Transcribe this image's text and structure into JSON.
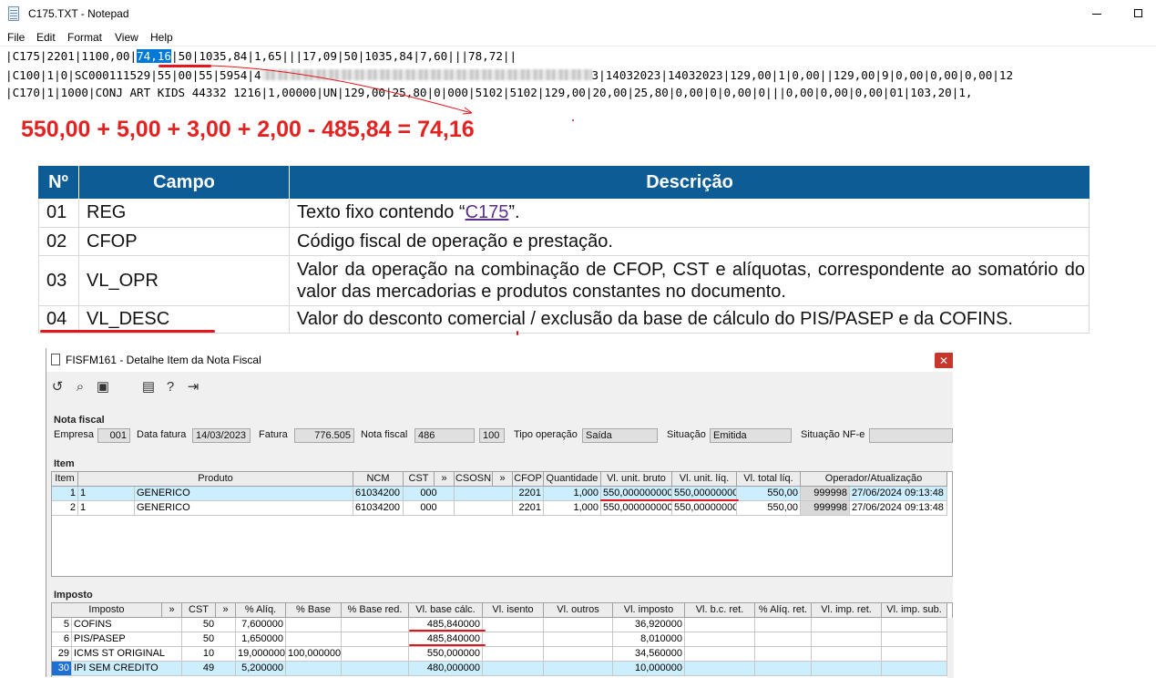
{
  "notepad": {
    "title": "C175.TXT - Notepad",
    "menu": [
      "File",
      "Edit",
      "Format",
      "View",
      "Help"
    ],
    "line1": {
      "pre": "|C175|2201|1100,00|",
      "selected": "74,16",
      "post": "|50|1035,84|1,65|||17,09|50|1035,84|7,60|||78,72||"
    },
    "line2": {
      "pre": "|C100|1|0|SC000111529|55|00|55|5954|4",
      "post": "3|14032023|14032023|129,00|1|0,00||129,00|9|0,00|0,00|0,00|12"
    },
    "line3": "|C170|1|1000|CONJ ART KIDS 44332 1216|1,00000|UN|129,00|25,80|0|000|5102|5102|129,00|20,00|25,80|0,00|0|0,00|0|||0,00|0,00|0,00|01|103,20|1,"
  },
  "formula": "550,00 + 5,00 + 3,00 + 2,00 - 485,84 = 74,16",
  "c175_table": {
    "headers": [
      "Nº",
      "Campo",
      "Descrição"
    ],
    "rows": [
      {
        "n": "01",
        "campo": "REG",
        "desc_pre": "Texto fixo contendo “",
        "desc_link": "C175",
        "desc_post": "”."
      },
      {
        "n": "02",
        "campo": "CFOP",
        "desc": "Código fiscal de operação e prestação."
      },
      {
        "n": "03",
        "campo": "VL_OPR",
        "desc": "Valor da operação na combinação de CFOP, CST e alíquotas, correspondente ao somatório do valor das mercadorias e produtos constantes no documento."
      },
      {
        "n": "04",
        "campo": "VL_DESC",
        "desc": "Valor do desconto comercial / exclusão da base de cálculo do PIS/PASEP e da COFINS."
      }
    ]
  },
  "form": {
    "title": "FISFM161 - Detalhe Item da Nota Fiscal",
    "close_label": "✕",
    "nota_fiscal": {
      "section": "Nota fiscal",
      "empresa_label": "Empresa",
      "empresa": "001",
      "data_fatura_label": "Data fatura",
      "data_fatura": "14/03/2023",
      "fatura_label": "Fatura",
      "fatura": "776.505",
      "nota_fiscal_label": "Nota fiscal",
      "nota_fiscal": "486",
      "serie": "100",
      "tipo_operacao_label": "Tipo operação",
      "tipo_operacao": "Saída",
      "situacao_label": "Situação",
      "situacao": "Emitida",
      "situacao_nfe_label": "Situação NF-e",
      "situacao_nfe": ""
    },
    "item": {
      "section": "Item",
      "headers": [
        "Item",
        "Produto",
        "NCM",
        "CST",
        "»",
        "CSOSN",
        "»",
        "CFOP",
        "Quantidade",
        "Vl. unit. bruto",
        "Vl. unit. líq.",
        "Vl. total líq.",
        "Operador/Atualização"
      ],
      "rows": [
        {
          "item": "1",
          "cod": "1",
          "produto": "GENERICO",
          "ncm": "61034200",
          "cst": "000",
          "csosn": "",
          "cfop": "2201",
          "quantidade": "1,000",
          "unit_bruto": "550,000000000",
          "unit_liq": "550,000000000",
          "total_liq": "550,00",
          "operador": "999998",
          "atualizacao": "27/06/2024 09:13:48"
        },
        {
          "item": "2",
          "cod": "1",
          "produto": "GENERICO",
          "ncm": "61034200",
          "cst": "000",
          "csosn": "",
          "cfop": "2201",
          "quantidade": "1,000",
          "unit_bruto": "550,000000000",
          "unit_liq": "550,000000000",
          "total_liq": "550,00",
          "operador": "999998",
          "atualizacao": "27/06/2024 09:13:48"
        }
      ]
    },
    "imposto": {
      "section": "Imposto",
      "headers": [
        "Imposto",
        "»",
        "CST",
        "»",
        "% Alíq.",
        "% Base",
        "% Base red.",
        "Vl. base cálc.",
        "Vl. isento",
        "Vl. outros",
        "Vl. imposto",
        "Vl. b.c. ret.",
        "% Alíq. ret.",
        "Vl. imp. ret.",
        "Vl. imp. sub."
      ],
      "rows": [
        {
          "code": "5",
          "name": "COFINS",
          "cst": "50",
          "aliq": "7,600000",
          "base": "",
          "base_red": "",
          "base_calc": "485,840000",
          "isento": "",
          "outros": "",
          "imposto": "36,920000"
        },
        {
          "code": "6",
          "name": "PIS/PASEP",
          "cst": "50",
          "aliq": "1,650000",
          "base": "",
          "base_red": "",
          "base_calc": "485,840000",
          "isento": "",
          "outros": "",
          "imposto": "8,010000"
        },
        {
          "code": "29",
          "name": "ICMS ST ORIGINAL",
          "cst": "10",
          "aliq": "19,000000",
          "base": "100,000000",
          "base_red": "",
          "base_calc": "550,000000",
          "isento": "",
          "outros": "",
          "imposto": "34,560000"
        },
        {
          "code": "30",
          "name": "IPI SEM CREDITO",
          "cst": "49",
          "aliq": "5,200000",
          "base": "",
          "base_red": "",
          "base_calc": "480,000000",
          "isento": "",
          "outros": "",
          "imposto": "10,000000"
        }
      ]
    }
  },
  "colors": {
    "annotation_red": "#e8141b",
    "table_header_blue": "#0d5c96",
    "selection_blue": "#0078d7",
    "row_selected": "#cdeefc"
  }
}
